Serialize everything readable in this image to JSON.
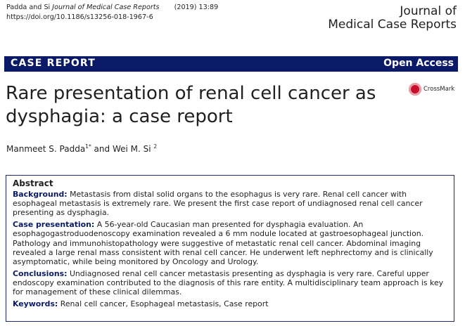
{
  "header": {
    "citation_authors": "Padda and Si",
    "citation_journal": "Journal of Medical Case Reports",
    "citation_year_volume": "(2019) 13:89",
    "doi": "https://doi.org/10.1186/s13256-018-1967-6",
    "journal_line1": "Journal of",
    "journal_line2": "Medical Case Reports"
  },
  "banner": {
    "article_type": "CASE REPORT",
    "access": "Open Access",
    "color": "#0b1a66"
  },
  "title": {
    "line1": "Rare presentation of renal cell cancer as",
    "line2": "dysphagia: a case report"
  },
  "crossmark": {
    "label": "CrossMark",
    "icon": "crossmark-icon"
  },
  "authors": {
    "author1": "Manmeet S. Padda",
    "author1_sup": "1*",
    "connector": "and",
    "author2": "Wei M. Si",
    "author2_sup": "2"
  },
  "abstract": {
    "heading": "Abstract",
    "background_label": "Background:",
    "background_text": "Metastasis from distal solid organs to the esophagus is very rare. Renal cell cancer with esophageal metastasis is extremely rare. We present the first case report of undiagnosed renal cell cancer presenting as dysphagia.",
    "case_label": "Case presentation:",
    "case_text": "A 56-year-old Caucasian man presented for dysphagia evaluation. An esophagogastroduodenoscopy examination revealed a 6 mm nodule located at gastroesophageal junction. Pathology and immunohistopathology were suggestive of metastatic renal cell cancer. Abdominal imaging revealed a large renal mass consistent with renal cell cancer. He underwent left nephrectomy and is clinically asymptomatic, while being monitored by Oncology and Urology.",
    "conclusions_label": "Conclusions:",
    "conclusions_text": "Undiagnosed renal cell cancer metastasis presenting as dysphagia is very rare. Careful upper endoscopy examination contributed to the diagnosis of this rare entity. A multidisciplinary team approach is key for management of these clinical dilemmas.",
    "keywords_label": "Keywords:",
    "keywords_text": "Renal cell cancer, Esophageal metastasis, Case report"
  }
}
